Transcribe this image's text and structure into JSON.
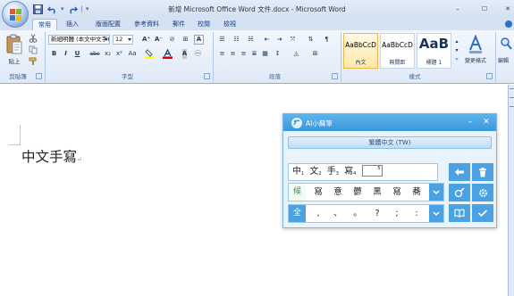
{
  "window": {
    "title": "新增 Microsoft Office Word 文件.docx - Microsoft Word",
    "minimize_symbol": "–",
    "maximize_symbol": "☐",
    "close_symbol": "✕"
  },
  "quick_access": {
    "separator": "|",
    "customize_symbol": "▾"
  },
  "ribbon_tabs": [
    "常用",
    "插入",
    "版面配置",
    "參考資料",
    "郵件",
    "校閱",
    "檢視"
  ],
  "ribbon": {
    "clipboard": {
      "paste_label": "貼上",
      "group_label": "剪貼簿"
    },
    "font": {
      "font_name": "新細明體 (本文中文字)",
      "font_size": "12",
      "group_label": "字型",
      "row2": [
        "B",
        "I",
        "U",
        "abe",
        "x₂",
        "x²",
        "Aa"
      ]
    },
    "paragraph": {
      "group_label": "段落"
    },
    "styles": {
      "group_label": "樣式",
      "items": [
        {
          "sample": "AaBbCcD",
          "name": "內文"
        },
        {
          "sample": "AaBbCcD",
          "name": "無間距"
        },
        {
          "sample": "AaB",
          "name": "標題 1"
        }
      ],
      "change_styles_label": "變更樣式"
    },
    "editing_label": "編輯"
  },
  "document": {
    "text": "中文手寫",
    "paragraph_mark": "↵"
  },
  "ime": {
    "title": "AI小蘇筆",
    "minimize_symbol": "–",
    "close_symbol": "✕",
    "mode": "繁體中文 (TW)",
    "input": [
      {
        "char": "中",
        "index": "1"
      },
      {
        "char": "文",
        "index": "2"
      },
      {
        "char": "手",
        "index": "3"
      },
      {
        "char": "寫",
        "index": "4"
      }
    ],
    "cursor_index": "5",
    "candidates": {
      "lead": "候",
      "items": [
        "寫",
        "意",
        "鬱",
        "黑",
        "寫",
        "蕎"
      ]
    },
    "punctuation": {
      "lead": "全",
      "items": [
        ",",
        "、",
        "。",
        "?",
        ";",
        ":"
      ]
    }
  },
  "colors": {
    "ribbon_bg": "#dfe9f7",
    "ime_header": "#3b98db",
    "ime_button": "#4aa2e3",
    "ime_candidate_lead": "#3a9b3a"
  }
}
